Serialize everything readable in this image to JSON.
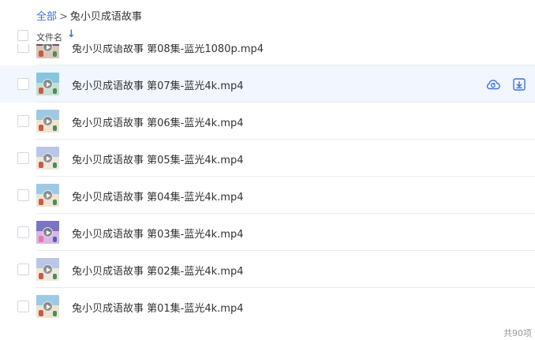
{
  "breadcrumb": {
    "root": "全部",
    "separator": ">",
    "current": "兔小贝成语故事"
  },
  "header": {
    "column_name": "文件名",
    "sort_icon": "arrow-down-icon"
  },
  "files": [
    {
      "name": "兔小贝成语故事 第08集-蓝光1080p.mp4",
      "thumb": "t-e"
    },
    {
      "name": "兔小贝成语故事 第07集-蓝光4k.mp4",
      "thumb": "t-b",
      "hover": true
    },
    {
      "name": "兔小贝成语故事 第06集-蓝光4k.mp4",
      "thumb": "t-a"
    },
    {
      "name": "兔小贝成语故事 第05集-蓝光4k.mp4",
      "thumb": "t-c"
    },
    {
      "name": "兔小贝成语故事 第04集-蓝光4k.mp4",
      "thumb": "t-a"
    },
    {
      "name": "兔小贝成语故事 第03集-蓝光4k.mp4",
      "thumb": "t-d"
    },
    {
      "name": "兔小贝成语故事 第02集-蓝光4k.mp4",
      "thumb": "t-c"
    },
    {
      "name": "兔小贝成语故事 第01集-蓝光4k.mp4",
      "thumb": "t-a"
    }
  ],
  "row_actions": {
    "cloud_icon": "cloud-refresh-icon",
    "download_icon": "download-icon"
  },
  "footer": {
    "total": "共90项"
  },
  "colors": {
    "accent": "#3b6fe0",
    "hover_row": "#f1f6ff",
    "divider": "#e9ebef"
  }
}
